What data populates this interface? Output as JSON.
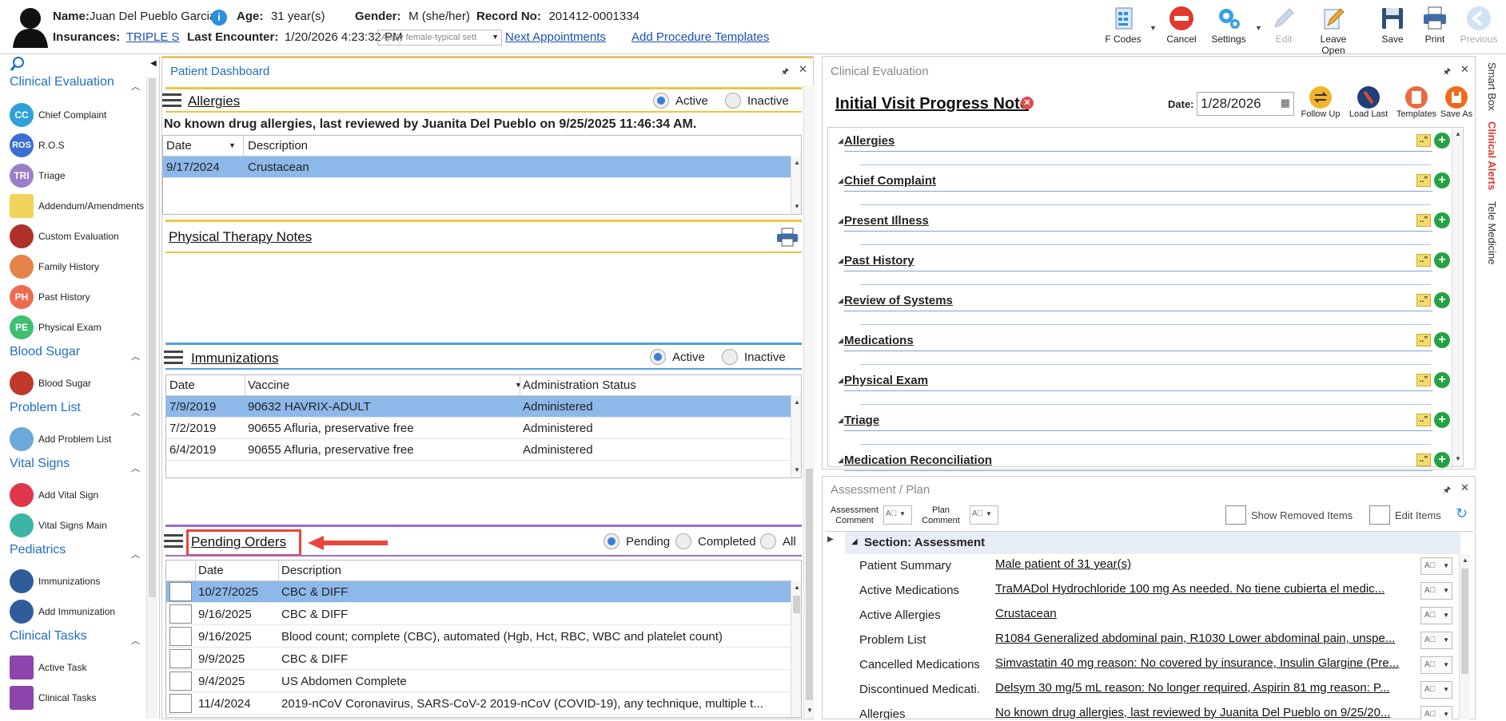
{
  "header": {
    "name_label": "Name:",
    "name": "Juan Del Pueblo Garcia",
    "age_label": "Age:",
    "age": "31 year(s)",
    "gender_label": "Gender:",
    "gender": "M (she/her)",
    "record_label": "Record No:",
    "record": "201412-0001334",
    "insurances_label": "Insurances:",
    "insurance": "TRIPLE S",
    "last_encounter_label": "Last Encounter:",
    "last_encounter": "1/20/2026 4:23:32 PM",
    "template_select": "Apply female-typical sett",
    "next_appointments": "Next Appointments",
    "add_procedure_templates": "Add Procedure Templates"
  },
  "toolbar": {
    "fcodes": "F Codes",
    "cancel": "Cancel",
    "settings": "Settings",
    "edit": "Edit",
    "leave_open": "Leave Open",
    "save": "Save",
    "print": "Print",
    "previous": "Previous"
  },
  "leftnav": {
    "clinical_evaluation": "Clinical Evaluation",
    "chief_complaint": "Chief Complaint",
    "ros": "R.O.S",
    "triage": "Triage",
    "addendum": "Addendum/Amendments",
    "custom_evaluation": "Custom Evaluation",
    "family_history": "Family History",
    "past_history": "Past History",
    "physical_exam": "Physical Exam",
    "blood_sugar_head": "Blood Sugar",
    "blood_sugar": "Blood Sugar",
    "problem_list_head": "Problem List",
    "add_problem_list": "Add Problem List",
    "vital_signs_head": "Vital Signs",
    "add_vital_sign": "Add Vital Sign",
    "vital_signs_main": "Vital Signs Main",
    "pediatrics_head": "Pediatrics",
    "immunizations": "Immunizations",
    "add_immunization": "Add Immunization",
    "clinical_tasks_head": "Clinical Tasks",
    "active_task": "Active Task",
    "clinical_tasks": "Clinical Tasks",
    "badge_cc": "CC",
    "badge_ros": "ROS",
    "badge_tri": "TRI",
    "badge_ph": "PH",
    "badge_pe": "PE"
  },
  "dashboard": {
    "title": "Patient Dashboard",
    "allergies": {
      "title": "Allergies",
      "active": "Active",
      "inactive": "Inactive",
      "note": "No known drug allergies, last reviewed by Juanita Del Pueblo on 9/25/2025 11:46:34 AM.",
      "col_date": "Date",
      "col_desc": "Description",
      "rows": [
        {
          "date": "9/17/2024",
          "desc": "Crustacean"
        }
      ]
    },
    "pt_notes": "Physical Therapy Notes",
    "immunizations": {
      "title": "Immunizations",
      "active": "Active",
      "inactive": "Inactive",
      "col_date": "Date",
      "col_vaccine": "Vaccine",
      "col_status": "Administration Status",
      "rows": [
        {
          "date": "7/9/2019",
          "vaccine": "90632 HAVRIX-ADULT",
          "status": "Administered"
        },
        {
          "date": "7/2/2019",
          "vaccine": "90655 Afluria, preservative free",
          "status": "Administered"
        },
        {
          "date": "6/4/2019",
          "vaccine": "90655 Afluria, preservative free",
          "status": "Administered"
        }
      ]
    },
    "pending": {
      "title": "Pending Orders",
      "pending": "Pending",
      "completed": "Completed",
      "all": "All",
      "col_date": "Date",
      "col_desc": "Description",
      "rows": [
        {
          "date": "10/27/2025",
          "desc": "CBC & DIFF"
        },
        {
          "date": "9/16/2025",
          "desc": "CBC & DIFF"
        },
        {
          "date": "9/16/2025",
          "desc": "Blood count; complete (CBC), automated (Hgb, Hct, RBC, WBC and platelet count)"
        },
        {
          "date": "9/9/2025",
          "desc": "CBC & DIFF"
        },
        {
          "date": "9/4/2025",
          "desc": "US Abdomen Complete"
        },
        {
          "date": "11/4/2024",
          "desc": "2019-nCoV Coronavirus, SARS-CoV-2 2019-nCoV (COVID-19), any technique, multiple t..."
        }
      ]
    }
  },
  "clinical_eval": {
    "title": "Clinical Evaluation",
    "note_title": "Initial Visit Progress Note",
    "date_label": "Date:",
    "date": "1/28/2026",
    "follow_up": "Follow Up",
    "load_last": "Load Last",
    "templates": "Templates",
    "save_as": "Save As",
    "items": [
      "Allergies",
      "Chief Complaint",
      "Present Illness",
      "Past History",
      "Review of Systems",
      "Medications",
      "Physical Exam",
      "Triage",
      "Medication Reconciliation"
    ]
  },
  "assessment": {
    "title": "Assessment / Plan",
    "assessment_comment": "Assessment Comment",
    "plan_comment": "Plan Comment",
    "show_removed": "Show Removed Items",
    "edit_items": "Edit Items",
    "section": "Section: Assessment",
    "rows": [
      {
        "label": "Patient Summary",
        "value": "Male patient of 31 year(s)"
      },
      {
        "label": "Active Medications",
        "value": "TraMADol Hydrochloride 100 mg As needed.  No tiene cubierta el medic..."
      },
      {
        "label": "Active Allergies",
        "value": "Crustacean"
      },
      {
        "label": "Problem List",
        "value": "R1084 Generalized abdominal pain, R1030 Lower abdominal pain, unspe..."
      },
      {
        "label": "Cancelled Medications",
        "value": "Simvastatin 40 mg reason: No covered by insurance, Insulin Glargine (Pre..."
      },
      {
        "label": "Discontinued Medicati...",
        "value": "Delsym 30 mg/5 mL reason: No longer required, Aspirin 81 mg reason: P..."
      },
      {
        "label": "Allergies",
        "value": "No known drug allergies, last reviewed by Juanita Del Pueblo on 9/25/20..."
      }
    ]
  },
  "sidetabs": {
    "smart_box": "Smart Box",
    "clinical_alerts": "Clinical Alerts",
    "tele_medicine": "Tele Medicine"
  },
  "colors": {
    "accent": "#1f6fc5",
    "selected_row": "#8db8ea",
    "annotation_red": "#e8473c",
    "alert_red": "#d83a2f"
  }
}
